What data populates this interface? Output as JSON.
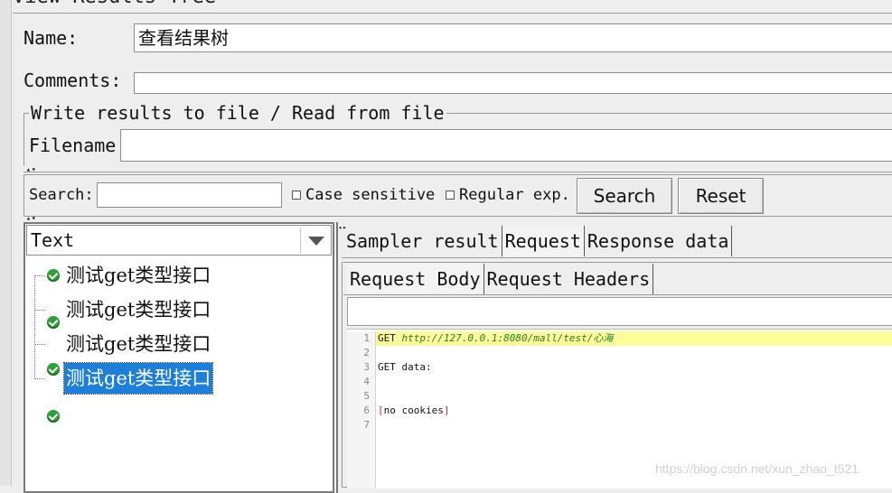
{
  "window": {
    "title": "View Results Tree"
  },
  "name_field": {
    "label": "Name:",
    "value": "查看结果树"
  },
  "comments_field": {
    "label": "Comments:",
    "value": ""
  },
  "file_group": {
    "legend": "Write results to file / Read from file",
    "filename_label": "Filename",
    "filename_value": ""
  },
  "search_bar": {
    "label": "Search:",
    "value": "",
    "case_sensitive_label": "Case sensitive",
    "regex_label": "Regular exp.",
    "search_button": "Search",
    "reset_button": "Reset"
  },
  "renderer": {
    "selected": "Text"
  },
  "results_tree": {
    "items": [
      {
        "label": "测试get类型接口",
        "status": "success"
      },
      {
        "label": "测试get类型接口",
        "status": "success"
      },
      {
        "label": "测试get类型接口",
        "status": "success"
      },
      {
        "label": "测试get类型接口",
        "status": "success",
        "selected": true
      }
    ]
  },
  "main_tabs": [
    "Sampler result",
    "Request",
    "Response data"
  ],
  "main_tab_selected": "Request",
  "sub_tabs": [
    "Request Body",
    "Request Headers"
  ],
  "sub_tab_selected": "Request Body",
  "request_body": {
    "lines": [
      {
        "no": "1",
        "method": "GET ",
        "url": "http://127.0.0.1:8080/mall/test/心海"
      },
      {
        "no": "2",
        "text": ""
      },
      {
        "no": "3",
        "text": "GET data:"
      },
      {
        "no": "4",
        "text": ""
      },
      {
        "no": "5",
        "text": ""
      },
      {
        "no": "6",
        "open": "[",
        "text": "no cookies",
        "close": "]"
      },
      {
        "no": "7",
        "text": ""
      }
    ]
  },
  "watermark": "https://blog.csdn.net/xun_zhao_t521",
  "colors": {
    "selection": "#1e7fd8",
    "success_icon": "#2e9e38",
    "line_highlight": "#fdfd9a"
  }
}
